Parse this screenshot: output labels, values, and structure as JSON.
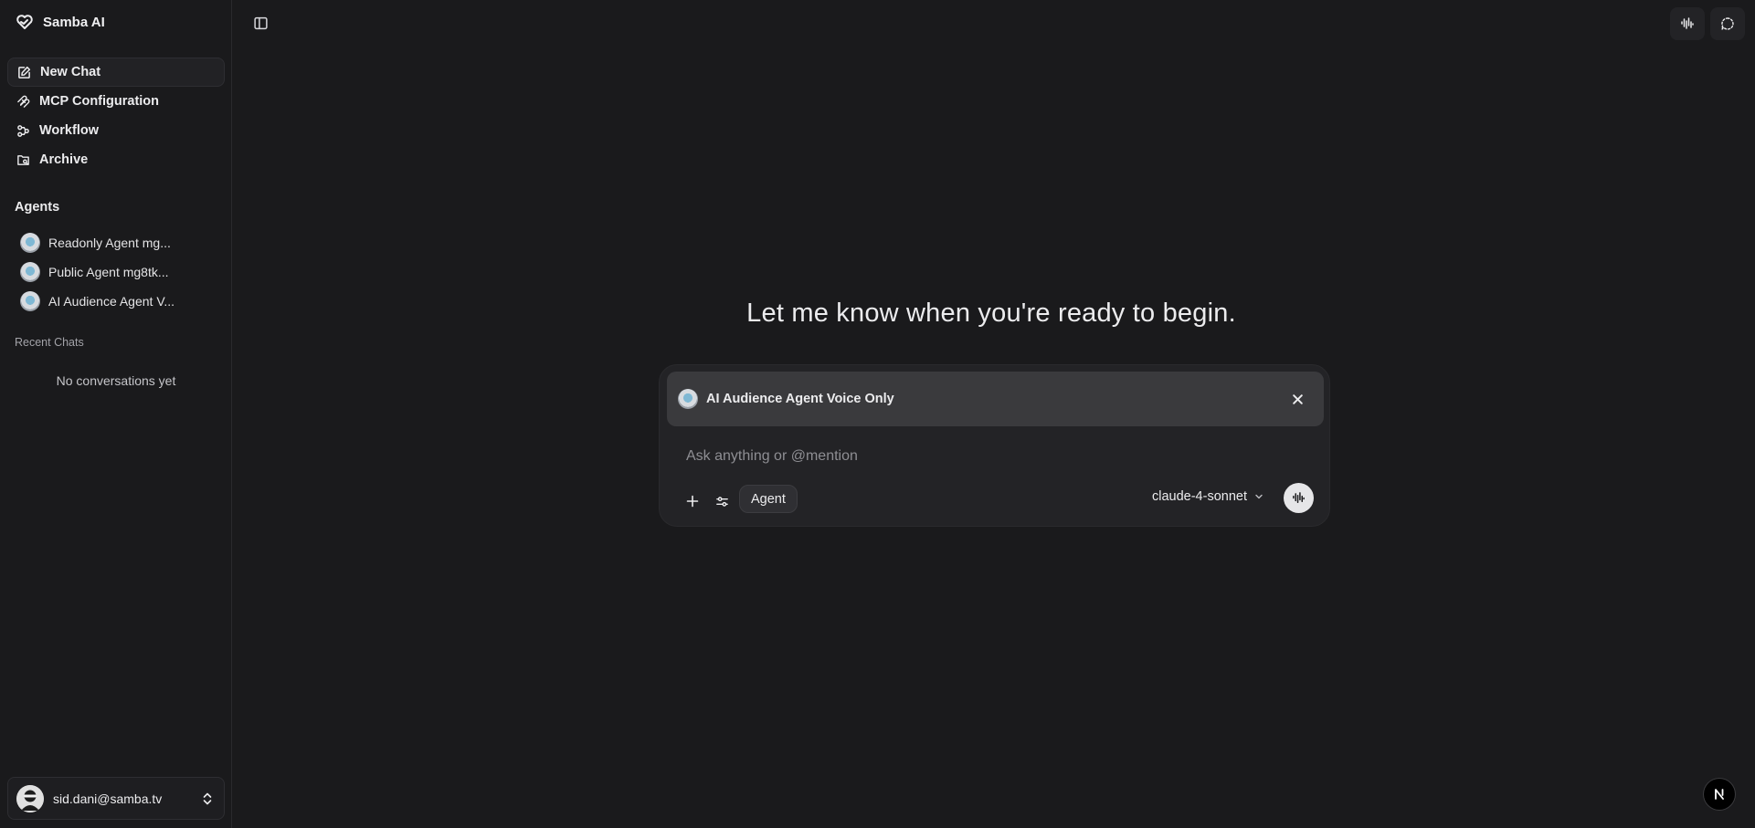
{
  "app": {
    "name": "Samba AI"
  },
  "sidebar": {
    "nav": [
      {
        "label": "New Chat",
        "icon": "edit-icon",
        "active": true
      },
      {
        "label": "MCP Configuration",
        "icon": "mcp-icon"
      },
      {
        "label": "Workflow",
        "icon": "workflow-icon"
      },
      {
        "label": "Archive",
        "icon": "archive-icon"
      }
    ],
    "agents_title": "Agents",
    "agents": [
      {
        "label": "Readonly Agent mg..."
      },
      {
        "label": "Public Agent mg8tk..."
      },
      {
        "label": "AI Audience Agent V..."
      }
    ],
    "recent_title": "Recent Chats",
    "recent_empty": "No conversations yet",
    "user": {
      "email": "sid.dani@samba.tv"
    }
  },
  "main": {
    "heading": "Let me know when you're ready to begin.",
    "composer": {
      "selected_agent": "AI Audience Agent Voice Only",
      "placeholder": "Ask anything or @mention",
      "mode_label": "Agent",
      "model": "claude-4-sonnet"
    }
  },
  "colors": {
    "background": "#1a1a1c",
    "panel": "#232326",
    "chip": "#3a3a3d"
  }
}
